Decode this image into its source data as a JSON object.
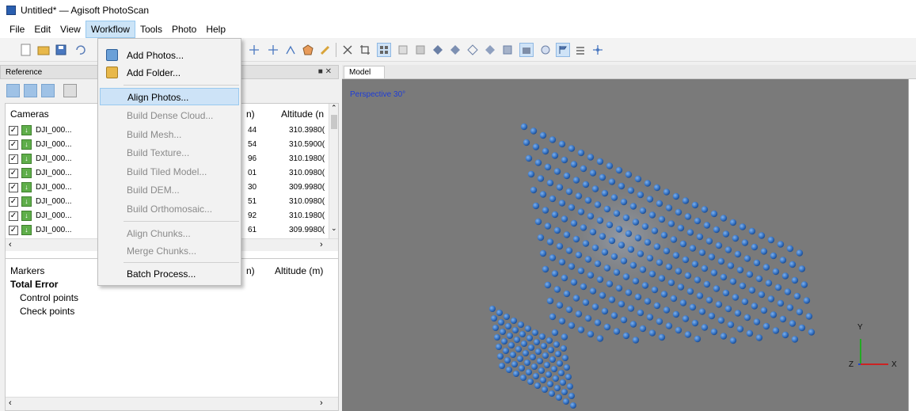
{
  "window": {
    "title": "Untitled* — Agisoft PhotoScan"
  },
  "menubar": [
    "File",
    "Edit",
    "View",
    "Workflow",
    "Tools",
    "Photo",
    "Help"
  ],
  "reference_panel": {
    "title": "Reference",
    "cameras": {
      "headers": {
        "name": "Cameras",
        "mid": "n)",
        "altitude": "Altitude (n"
      },
      "rows": [
        {
          "name": "DJI_000...",
          "mid": "44",
          "altitude": "310.3980("
        },
        {
          "name": "DJI_000...",
          "mid": "54",
          "altitude": "310.5900("
        },
        {
          "name": "DJI_000...",
          "mid": "96",
          "altitude": "310.1980("
        },
        {
          "name": "DJI_000...",
          "mid": "01",
          "altitude": "310.0980("
        },
        {
          "name": "DJI_000...",
          "mid": "30",
          "altitude": "309.9980("
        },
        {
          "name": "DJI_000...",
          "mid": "51",
          "altitude": "310.0980("
        },
        {
          "name": "DJI_000...",
          "mid": "92",
          "altitude": "310.1980("
        },
        {
          "name": "DJI_000...",
          "mid": "61",
          "altitude": "309.9980("
        }
      ]
    },
    "markers": {
      "headers": {
        "name": "Markers",
        "mid": "n)",
        "altitude": "Altitude (m)"
      },
      "total_error": "Total Error",
      "control_points": "Control points",
      "check_points": "Check points"
    }
  },
  "workflow_menu": {
    "items": [
      {
        "label": "Add Photos...",
        "enabled": true
      },
      {
        "label": "Add Folder...",
        "enabled": true
      },
      {
        "label": "Align Photos...",
        "enabled": true,
        "highlighted": true
      },
      {
        "label": "Build Dense Cloud...",
        "enabled": false
      },
      {
        "label": "Build Mesh...",
        "enabled": false
      },
      {
        "label": "Build Texture...",
        "enabled": false
      },
      {
        "label": "Build Tiled Model...",
        "enabled": false
      },
      {
        "label": "Build DEM...",
        "enabled": false
      },
      {
        "label": "Build Orthomosaic...",
        "enabled": false
      },
      {
        "label": "Align Chunks...",
        "enabled": false
      },
      {
        "label": "Merge Chunks...",
        "enabled": false
      },
      {
        "label": "Batch Process...",
        "enabled": true
      }
    ]
  },
  "model_view": {
    "tab": "Model",
    "projection": "Perspective 30°",
    "axes": {
      "y": "Y",
      "z": "Z",
      "x": "X"
    }
  },
  "colors": {
    "camera_sphere": "#3b78c8",
    "viewport_bg": "#7a7a7a",
    "highlight": "#cde3f7",
    "perspective_text": "#1f3dd6"
  }
}
